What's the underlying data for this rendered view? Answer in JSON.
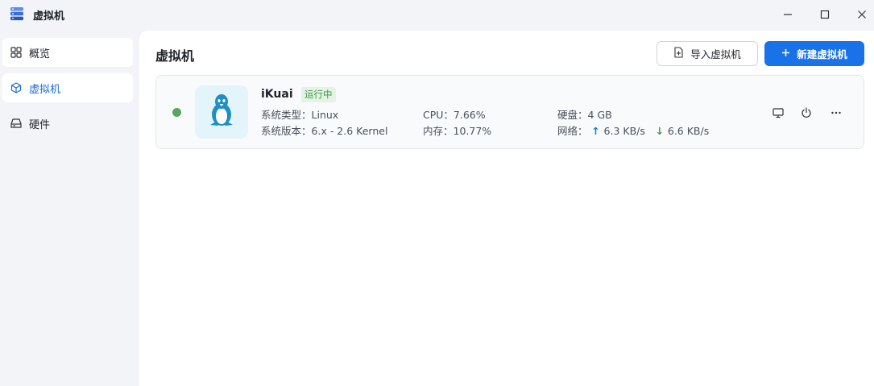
{
  "window": {
    "title": "虚拟机",
    "app_icon": "server-stack-icon"
  },
  "sidebar": {
    "items": [
      {
        "label": "概览",
        "icon": "grid-icon"
      },
      {
        "label": "虚拟机",
        "icon": "cube-icon",
        "active": true
      },
      {
        "label": "硬件",
        "icon": "drive-icon"
      }
    ]
  },
  "main": {
    "title": "虚拟机",
    "import_button": "导入虚拟机",
    "new_button": "新建虚拟机"
  },
  "vms": [
    {
      "name": "iKuai",
      "status": "运行中",
      "os_icon": "linux-penguin-icon",
      "os_type_label": "系统类型：",
      "os_type": "Linux",
      "os_version_label": "系统版本：",
      "os_version": "6.x - 2.6 Kernel",
      "cpu_label": "CPU：",
      "cpu": "7.66%",
      "memory_label": "内存：",
      "memory": "10.77%",
      "disk_label": "硬盘：",
      "disk": "4 GB",
      "network_label": "网络：",
      "net_up": "6.3 KB/s",
      "net_down": "6.6 KB/s"
    }
  ],
  "colors": {
    "accent": "#1a72e8",
    "running": "#5aa65e",
    "status_bg": "#e4f3e4",
    "status_text": "#3c9a43"
  }
}
